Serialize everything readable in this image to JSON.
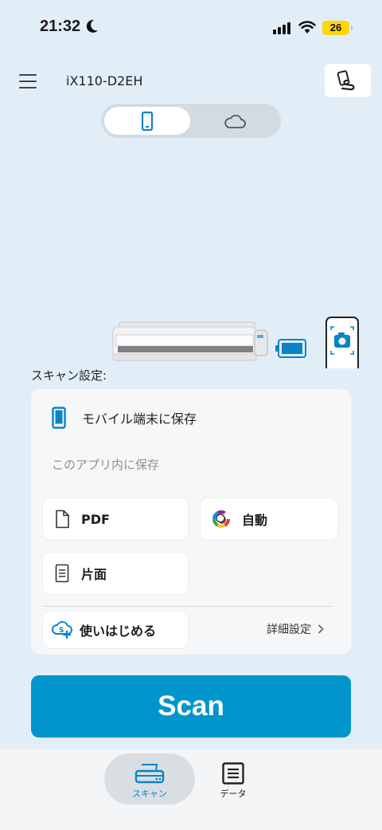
{
  "status_bar": {
    "time": "21:32",
    "battery": "26"
  },
  "header": {
    "device_name": "iX110-D2EH"
  },
  "segments": [
    {
      "icon": "smartphone-icon",
      "active": true
    },
    {
      "icon": "cloud-icon",
      "active": false
    }
  ],
  "scan_settings": {
    "heading": "スキャン設定:",
    "save_target": "モバイル端末に保存",
    "save_sub": "このアプリ内に保存",
    "format": "PDF",
    "color_mode": "自動",
    "sides": "片面",
    "getting_started": "使いはじめる",
    "detailed_settings": "詳細設定"
  },
  "scan_button": "Scan",
  "tabs": [
    {
      "label": "スキャン",
      "active": true
    },
    {
      "label": "データ",
      "active": false
    }
  ],
  "colors": {
    "accent": "#0096cc",
    "background": "#e2eef7"
  }
}
